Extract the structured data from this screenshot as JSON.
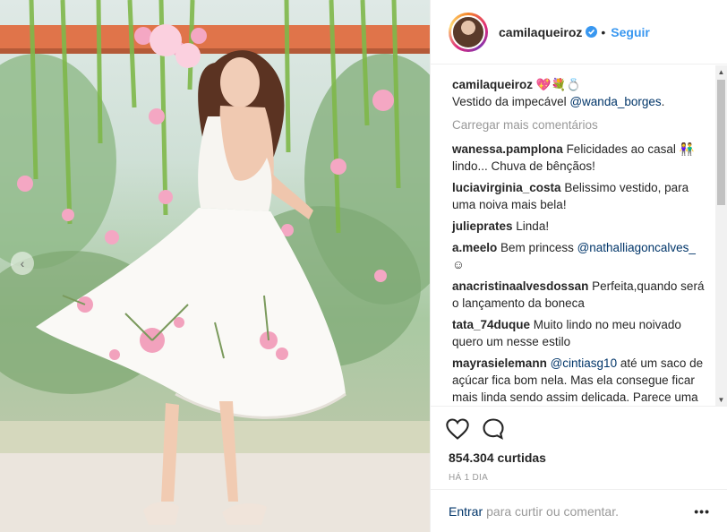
{
  "post": {
    "username": "camilaqueiroz",
    "follow_label": "Seguir",
    "separator": "•"
  },
  "caption": {
    "username": "camilaqueiroz",
    "emoji": "💖💐💍",
    "text": "Vestido da impecável ",
    "mention": "@wanda_borges",
    "suffix": "."
  },
  "load_more": "Carregar mais comentários",
  "comments": [
    {
      "user": "wanessa.pamplona",
      "text": "Felicidades ao casal 👫 lindo... Chuva de bênçãos!"
    },
    {
      "user": "luciavirginia_costa",
      "text": "Belissimo vestido, para uma noiva mais bela!"
    },
    {
      "user": "julieprates",
      "text": "Linda!"
    },
    {
      "user": "a.meelo",
      "text": "Bem princess ",
      "mention": "@nathalliagoncalves_",
      "tail": " ☺"
    },
    {
      "user": "anacristinaalvesdossan",
      "text": "Perfeita,quando será o lançamento da boneca"
    },
    {
      "user": "tata_74duque",
      "text": "Muito lindo no meu noivado quero um nesse estilo"
    },
    {
      "user": "mayrasielemann",
      "mention": "@cintiasg10",
      "text": " até um saco de açúcar fica bom nela. Mas ela consegue ficar mais linda sendo assim delicada. Parece uma princesa da Disney."
    }
  ],
  "likes": "854.304 curtidas",
  "time": "HÁ 1 DIA",
  "comment_bar": {
    "login": "Entrar",
    "text": "para curtir ou comentar.",
    "more": "•••"
  },
  "icons": [
    "heart-icon",
    "comment-icon",
    "verified-icon",
    "chevron-left-icon",
    "more-options-icon"
  ],
  "colors": {
    "link": "#3897f0",
    "mention": "#003569",
    "muted": "#999999"
  }
}
